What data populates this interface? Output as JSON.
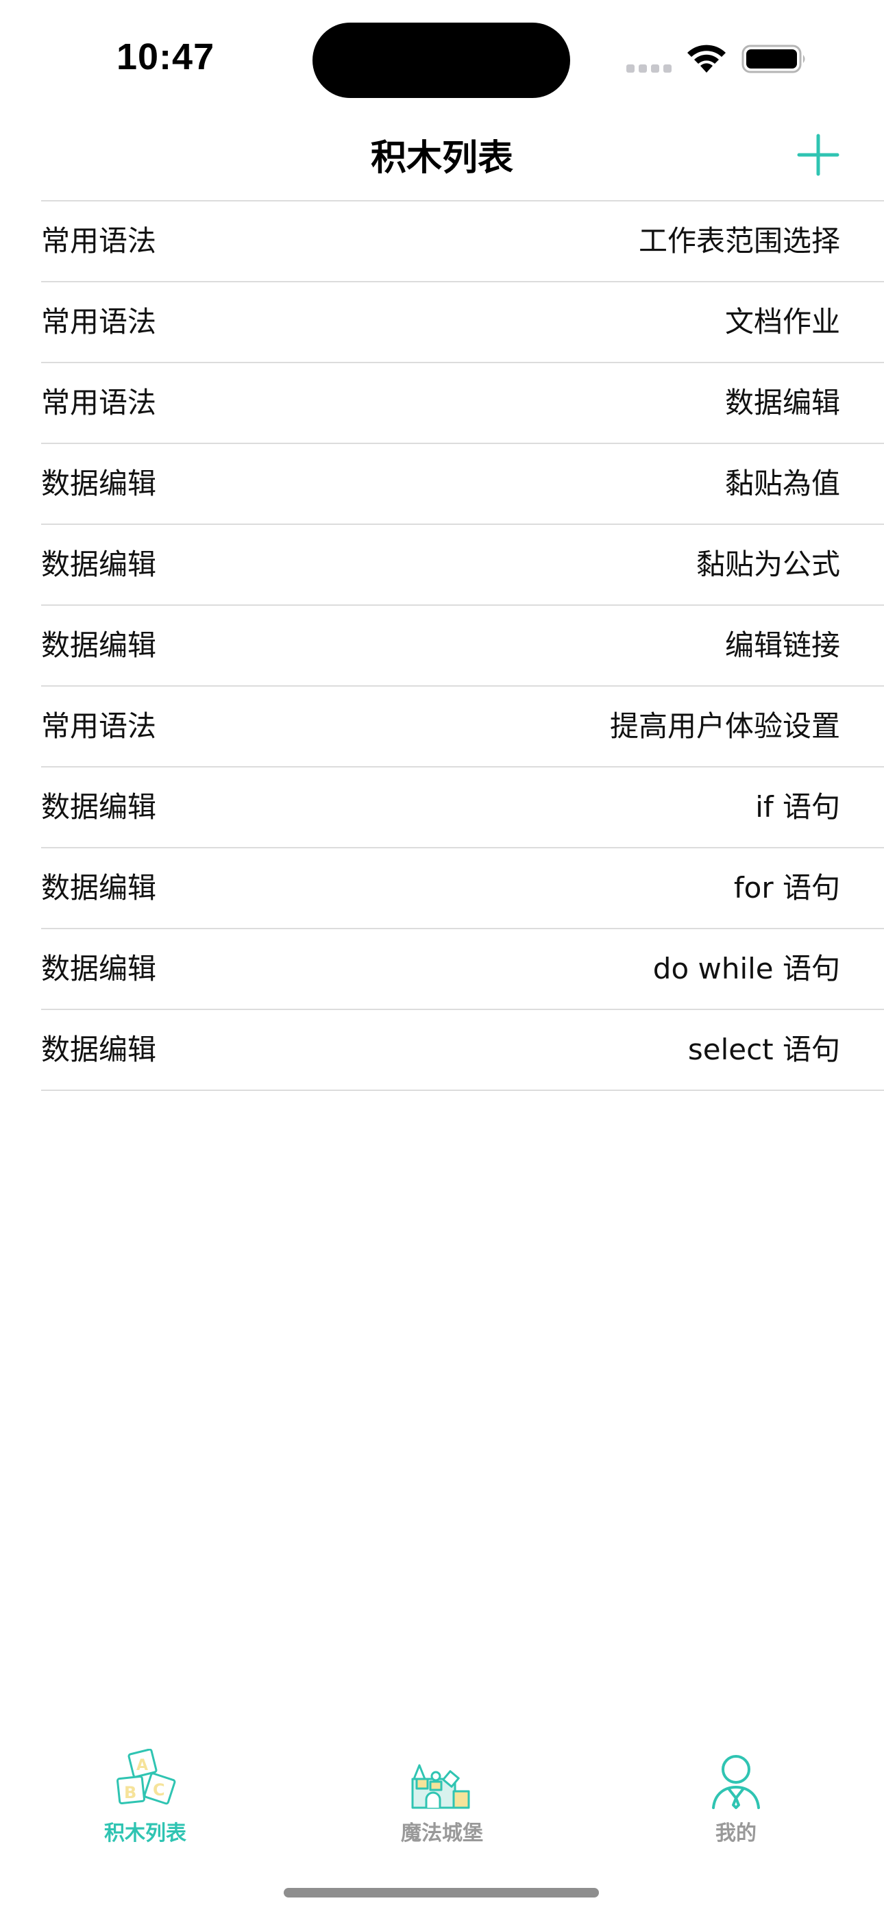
{
  "status_bar": {
    "time": "10:47"
  },
  "nav": {
    "title": "积木列表",
    "add_icon": "plus-icon",
    "accent_color": "#2fc4b2"
  },
  "list": {
    "rows": [
      {
        "category": "常用语法",
        "name": "工作表范围选择"
      },
      {
        "category": "常用语法",
        "name": "文档作业"
      },
      {
        "category": "常用语法",
        "name": "数据编辑"
      },
      {
        "category": "数据编辑",
        "name": "黏贴為值"
      },
      {
        "category": "数据编辑",
        "name": "黏贴为公式"
      },
      {
        "category": "数据编辑",
        "name": "编辑链接"
      },
      {
        "category": "常用语法",
        "name": "提高用户体验设置"
      },
      {
        "category": "数据编辑",
        "name": "if 语句"
      },
      {
        "category": "数据编辑",
        "name": "for 语句"
      },
      {
        "category": "数据编辑",
        "name": "do while 语句"
      },
      {
        "category": "数据编辑",
        "name": "select 语句"
      }
    ]
  },
  "tab_bar": {
    "tabs": [
      {
        "label": "积木列表",
        "icon": "abc-blocks-icon",
        "active": true
      },
      {
        "label": "魔法城堡",
        "icon": "castle-icon",
        "active": false
      },
      {
        "label": "我的",
        "icon": "user-icon",
        "active": false
      }
    ],
    "active_color": "#2fc4b2",
    "inactive_color": "#999999"
  }
}
